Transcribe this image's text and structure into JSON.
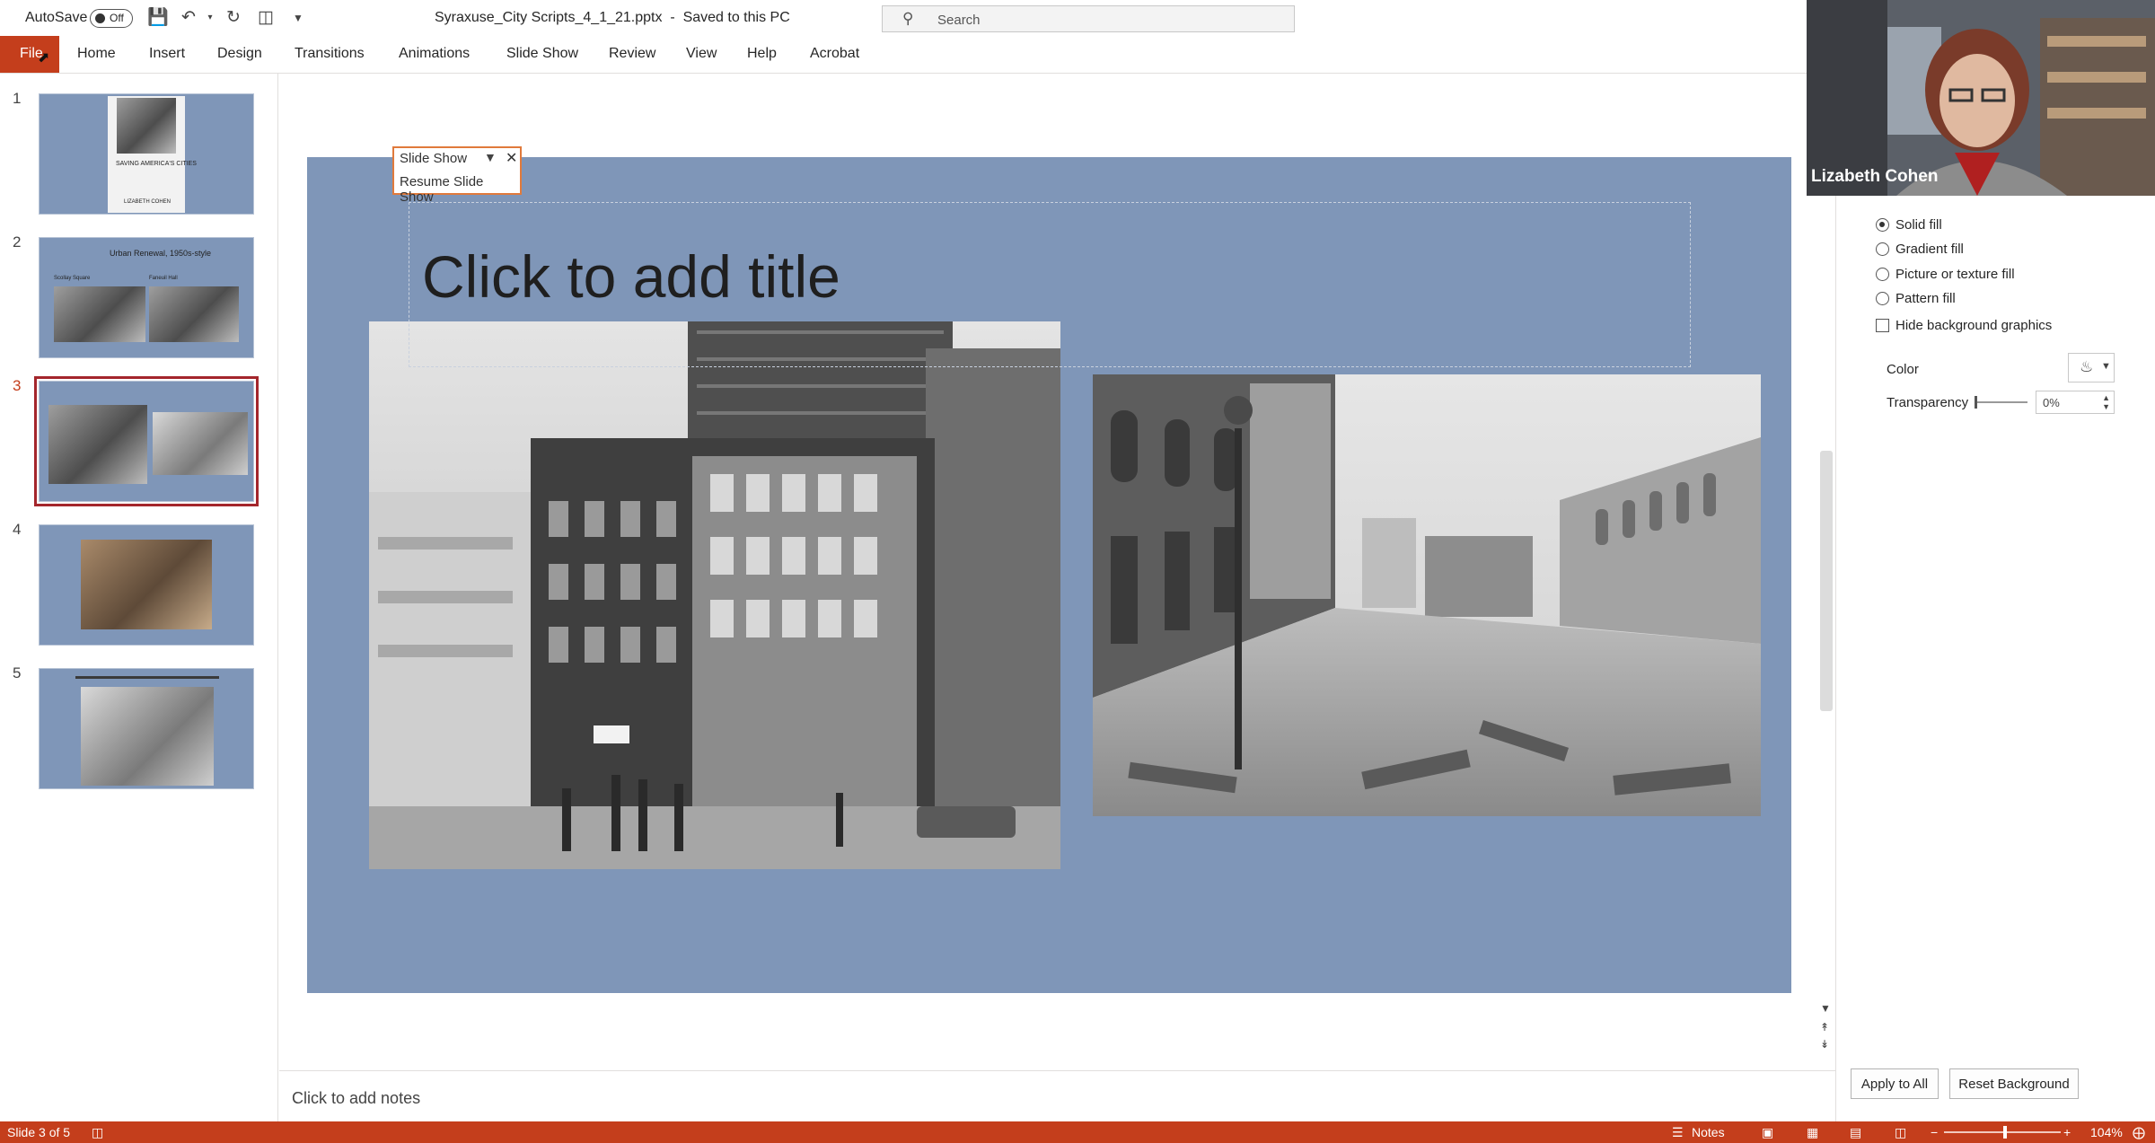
{
  "titlebar": {
    "autosave_label": "AutoSave",
    "autosave_state": "Off",
    "doc_title": "Syraxuse_City Scripts_4_1_21.pptx  -  Saved to this PC",
    "search_placeholder": "Search"
  },
  "ribbon": {
    "tabs": [
      "File",
      "Home",
      "Insert",
      "Design",
      "Transitions",
      "Animations",
      "Slide Show",
      "Review",
      "View",
      "Help",
      "Acrobat"
    ],
    "active_tab_color": "#c43e1c"
  },
  "thumbnails": {
    "numbers": [
      "1",
      "2",
      "3",
      "4",
      "5"
    ],
    "selected": "3",
    "slide1_title": "SAVING AMERICA'S CITIES",
    "slide1_author": "LIZABETH COHEN",
    "slide2_title": "Urban Renewal, 1950s-style",
    "slide2_cap_left": "Scollay Square",
    "slide2_cap_right": "Faneuil Hall"
  },
  "slide": {
    "title_placeholder": "Click to add title",
    "background_color": "#7f96b8"
  },
  "slideshow_popup": {
    "title": "Slide Show",
    "action": "Resume Slide Show"
  },
  "notes": {
    "placeholder": "Click to add notes"
  },
  "format_pane": {
    "fill_options": [
      "Solid fill",
      "Gradient fill",
      "Picture or texture fill",
      "Pattern fill"
    ],
    "selected_fill": "Solid fill",
    "hide_bg_graphics": "Hide background graphics",
    "color_label": "Color",
    "transparency_label": "Transparency",
    "transparency_value": "0%",
    "apply_all": "Apply to All",
    "reset_bg": "Reset Background"
  },
  "webcam": {
    "name": "Lizabeth Cohen"
  },
  "statusbar": {
    "slide_info": "Slide 3 of 5",
    "notes": "Notes",
    "zoom": "104%",
    "color": "#c43e1c"
  }
}
